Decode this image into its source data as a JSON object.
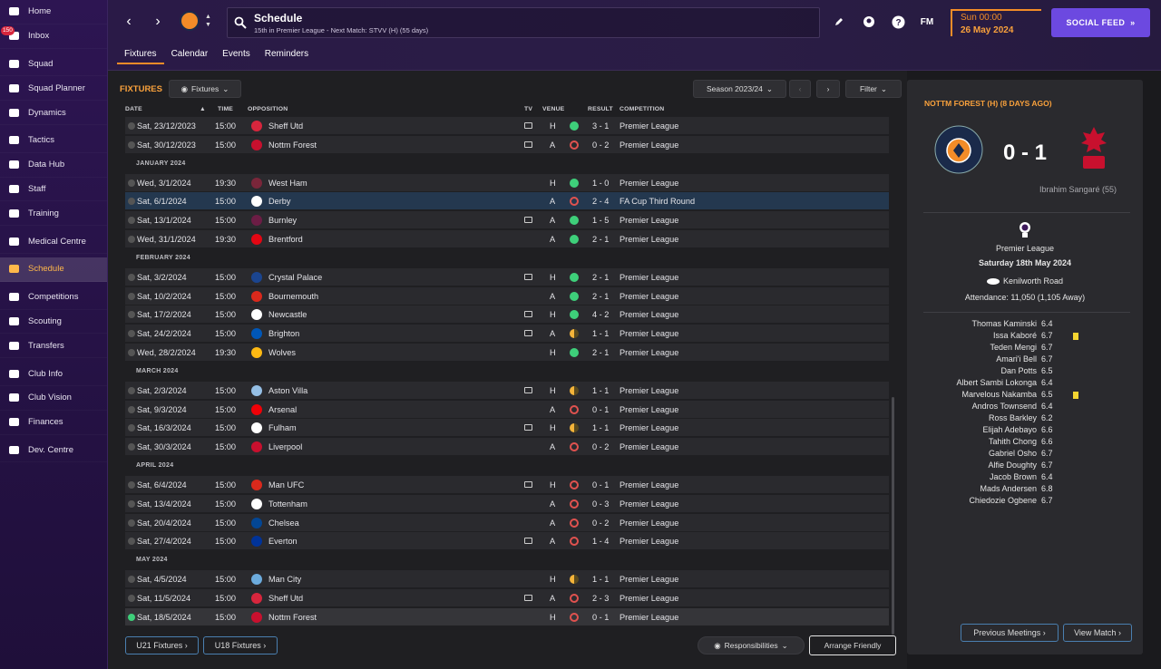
{
  "sidebar": [
    {
      "name": "home",
      "label": "Home",
      "icon": "home-icon"
    },
    {
      "name": "inbox",
      "label": "Inbox",
      "icon": "inbox-icon",
      "badge": "150"
    },
    {
      "name": "squad",
      "label": "Squad",
      "icon": "shirt-icon"
    },
    {
      "name": "squad-planner",
      "label": "Squad Planner",
      "icon": "clipboard-icon"
    },
    {
      "name": "dynamics",
      "label": "Dynamics",
      "icon": "handshake-icon"
    },
    {
      "name": "tactics",
      "label": "Tactics",
      "icon": "tactics-board-icon"
    },
    {
      "name": "data-hub",
      "label": "Data Hub",
      "icon": "pie-icon"
    },
    {
      "name": "staff",
      "label": "Staff",
      "icon": "people-icon"
    },
    {
      "name": "training",
      "label": "Training",
      "icon": "cone-icon"
    },
    {
      "name": "medical-centre",
      "label": "Medical Centre",
      "icon": "medical-icon"
    },
    {
      "name": "schedule",
      "label": "Schedule",
      "icon": "calendar-icon",
      "active": true
    },
    {
      "name": "competitions",
      "label": "Competitions",
      "icon": "trophy-icon"
    },
    {
      "name": "scouting",
      "label": "Scouting",
      "icon": "magnifier-icon"
    },
    {
      "name": "transfers",
      "label": "Transfers",
      "icon": "transfer-icon"
    },
    {
      "name": "club-info",
      "label": "Club Info",
      "icon": "shield-icon"
    },
    {
      "name": "club-vision",
      "label": "Club Vision",
      "icon": "briefcase-icon"
    },
    {
      "name": "finances",
      "label": "Finances",
      "icon": "money-icon"
    },
    {
      "name": "dev-centre",
      "label": "Dev. Centre",
      "icon": "shoe-icon"
    }
  ],
  "header": {
    "title": "Schedule",
    "subtitle": "15th in Premier League - Next Match: STVV (H) (55 days)",
    "date_time": "Sun 00:00",
    "date_day": "26 May 2024",
    "social": "SOCIAL FEED",
    "fm": "FM"
  },
  "tabs": [
    "Fixtures",
    "Calendar",
    "Events",
    "Reminders"
  ],
  "main": {
    "heading": "FIXTURES",
    "view_btn": "Fixtures",
    "season": "Season 2023/24",
    "filter": "Filter",
    "u21": "U21 Fixtures",
    "u18": "U18 Fixtures",
    "responsibilities": "Responsibilities",
    "arrange": "Arrange Friendly"
  },
  "columns": {
    "date": "DATE",
    "time": "TIME",
    "opposition": "OPPOSITION",
    "tv": "TV",
    "venue": "VENUE",
    "result": "RESULT",
    "competition": "COMPETITION"
  },
  "rows": [
    {
      "type": "m",
      "date": "Sat, 23/12/2023",
      "time": "15:00",
      "opp": "Sheff Utd",
      "tv": true,
      "venue": "H",
      "res": "W",
      "score": "3 - 1",
      "comp": "Premier League",
      "crest": "#d7263d"
    },
    {
      "type": "m",
      "date": "Sat, 30/12/2023",
      "time": "15:00",
      "opp": "Nottm Forest",
      "tv": true,
      "venue": "A",
      "res": "L",
      "score": "0 - 2",
      "comp": "Premier League",
      "crest": "#c8102e"
    },
    {
      "type": "h",
      "label": "JANUARY 2024"
    },
    {
      "type": "m",
      "date": "Wed, 3/1/2024",
      "time": "19:30",
      "opp": "West Ham",
      "tv": false,
      "venue": "H",
      "res": "W",
      "score": "1 - 0",
      "comp": "Premier League",
      "crest": "#7a263a"
    },
    {
      "type": "m",
      "date": "Sat, 6/1/2024",
      "time": "15:00",
      "opp": "Derby",
      "tv": false,
      "venue": "A",
      "res": "L",
      "score": "2 - 4",
      "comp": "FA Cup Third Round",
      "crest": "#ffffff",
      "sel": true
    },
    {
      "type": "m",
      "date": "Sat, 13/1/2024",
      "time": "15:00",
      "opp": "Burnley",
      "tv": true,
      "venue": "A",
      "res": "W",
      "score": "1 - 5",
      "comp": "Premier League",
      "crest": "#6c1d45"
    },
    {
      "type": "m",
      "date": "Wed, 31/1/2024",
      "time": "19:30",
      "opp": "Brentford",
      "tv": false,
      "venue": "A",
      "res": "W",
      "score": "2 - 1",
      "comp": "Premier League",
      "crest": "#e30613"
    },
    {
      "type": "h",
      "label": "FEBRUARY 2024"
    },
    {
      "type": "m",
      "date": "Sat, 3/2/2024",
      "time": "15:00",
      "opp": "Crystal Palace",
      "tv": true,
      "venue": "H",
      "res": "W",
      "score": "2 - 1",
      "comp": "Premier League",
      "crest": "#1b458f"
    },
    {
      "type": "m",
      "date": "Sat, 10/2/2024",
      "time": "15:00",
      "opp": "Bournemouth",
      "tv": false,
      "venue": "A",
      "res": "W",
      "score": "2 - 1",
      "comp": "Premier League",
      "crest": "#da291c"
    },
    {
      "type": "m",
      "date": "Sat, 17/2/2024",
      "time": "15:00",
      "opp": "Newcastle",
      "tv": true,
      "venue": "H",
      "res": "W",
      "score": "4 - 2",
      "comp": "Premier League",
      "crest": "#ffffff"
    },
    {
      "type": "m",
      "date": "Sat, 24/2/2024",
      "time": "15:00",
      "opp": "Brighton",
      "tv": true,
      "venue": "A",
      "res": "D",
      "score": "1 - 1",
      "comp": "Premier League",
      "crest": "#0057b8"
    },
    {
      "type": "m",
      "date": "Wed, 28/2/2024",
      "time": "19:30",
      "opp": "Wolves",
      "tv": false,
      "venue": "H",
      "res": "W",
      "score": "2 - 1",
      "comp": "Premier League",
      "crest": "#fdb913"
    },
    {
      "type": "h",
      "label": "MARCH 2024"
    },
    {
      "type": "m",
      "date": "Sat, 2/3/2024",
      "time": "15:00",
      "opp": "Aston Villa",
      "tv": true,
      "venue": "H",
      "res": "D",
      "score": "1 - 1",
      "comp": "Premier League",
      "crest": "#95bfe5"
    },
    {
      "type": "m",
      "date": "Sat, 9/3/2024",
      "time": "15:00",
      "opp": "Arsenal",
      "tv": false,
      "venue": "A",
      "res": "L",
      "score": "0 - 1",
      "comp": "Premier League",
      "crest": "#ef0107"
    },
    {
      "type": "m",
      "date": "Sat, 16/3/2024",
      "time": "15:00",
      "opp": "Fulham",
      "tv": true,
      "venue": "H",
      "res": "D",
      "score": "1 - 1",
      "comp": "Premier League",
      "crest": "#ffffff"
    },
    {
      "type": "m",
      "date": "Sat, 30/3/2024",
      "time": "15:00",
      "opp": "Liverpool",
      "tv": false,
      "venue": "A",
      "res": "L",
      "score": "0 - 2",
      "comp": "Premier League",
      "crest": "#c8102e"
    },
    {
      "type": "h",
      "label": "APRIL 2024"
    },
    {
      "type": "m",
      "date": "Sat, 6/4/2024",
      "time": "15:00",
      "opp": "Man UFC",
      "tv": true,
      "venue": "H",
      "res": "L",
      "score": "0 - 1",
      "comp": "Premier League",
      "crest": "#da291c"
    },
    {
      "type": "m",
      "date": "Sat, 13/4/2024",
      "time": "15:00",
      "opp": "Tottenham",
      "tv": false,
      "venue": "A",
      "res": "L",
      "score": "0 - 3",
      "comp": "Premier League",
      "crest": "#ffffff"
    },
    {
      "type": "m",
      "date": "Sat, 20/4/2024",
      "time": "15:00",
      "opp": "Chelsea",
      "tv": false,
      "venue": "A",
      "res": "L",
      "score": "0 - 2",
      "comp": "Premier League",
      "crest": "#034694"
    },
    {
      "type": "m",
      "date": "Sat, 27/4/2024",
      "time": "15:00",
      "opp": "Everton",
      "tv": true,
      "venue": "A",
      "res": "L",
      "score": "1 - 4",
      "comp": "Premier League",
      "crest": "#003399"
    },
    {
      "type": "h",
      "label": "MAY 2024"
    },
    {
      "type": "m",
      "date": "Sat, 4/5/2024",
      "time": "15:00",
      "opp": "Man City",
      "tv": false,
      "venue": "H",
      "res": "D",
      "score": "1 - 1",
      "comp": "Premier League",
      "crest": "#6cabdd"
    },
    {
      "type": "m",
      "date": "Sat, 11/5/2024",
      "time": "15:00",
      "opp": "Sheff Utd",
      "tv": true,
      "venue": "A",
      "res": "L",
      "score": "2 - 3",
      "comp": "Premier League",
      "crest": "#d7263d"
    },
    {
      "type": "m",
      "date": "Sat, 18/5/2024",
      "time": "15:00",
      "opp": "Nottm Forest",
      "tv": false,
      "venue": "H",
      "res": "L",
      "score": "0 - 1",
      "comp": "Premier League",
      "crest": "#c8102e",
      "hl": true,
      "done": true
    }
  ],
  "panel": {
    "title": "NOTTM FOREST (H) (8 DAYS AGO)",
    "score": "0 - 1",
    "scorer": "Ibrahim Sangaré (55)",
    "competition": "Premier League",
    "date": "Saturday 18th May 2024",
    "stadium": "Kenilworth Road",
    "attendance": "Attendance: 11,050 (1,105 Away)",
    "prev": "Previous Meetings",
    "view": "View Match",
    "players": [
      {
        "name": "Thomas Kaminski",
        "rating": "6.4"
      },
      {
        "name": "Issa Kaboré",
        "rating": "6.7",
        "yellow": true
      },
      {
        "name": "Teden Mengi",
        "rating": "6.7"
      },
      {
        "name": "Amari'i Bell",
        "rating": "6.7"
      },
      {
        "name": "Dan Potts",
        "rating": "6.5"
      },
      {
        "name": "Albert Sambi Lokonga",
        "rating": "6.4"
      },
      {
        "name": "Marvelous Nakamba",
        "rating": "6.5",
        "yellow": true
      },
      {
        "name": "Andros Townsend",
        "rating": "6.4"
      },
      {
        "name": "Ross Barkley",
        "rating": "6.2"
      },
      {
        "name": "Elijah Adebayo",
        "rating": "6.6"
      },
      {
        "name": "Tahith Chong",
        "rating": "6.6"
      },
      {
        "name": "Gabriel Osho",
        "rating": "6.7"
      },
      {
        "name": "Alfie Doughty",
        "rating": "6.7"
      },
      {
        "name": "Jacob Brown",
        "rating": "6.4"
      },
      {
        "name": "Mads Andersen",
        "rating": "6.8"
      },
      {
        "name": "Chiedozie Ogbene",
        "rating": "6.7"
      }
    ]
  },
  "colors": {
    "accent": "#f28c28",
    "win": "#3ecf7a",
    "loss": "#e0524f",
    "draw": "#f4b43a",
    "social": "#6c49e0"
  }
}
